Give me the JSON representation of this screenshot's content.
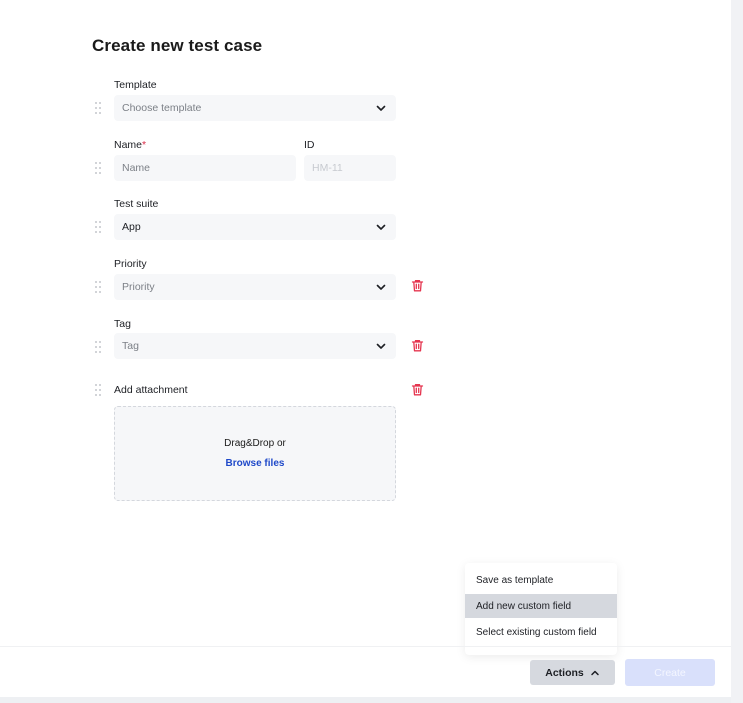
{
  "page": {
    "title": "Create new test case"
  },
  "form": {
    "template": {
      "label": "Template",
      "placeholder": "Choose template"
    },
    "name": {
      "label": "Name",
      "required_mark": "*",
      "placeholder": "Name"
    },
    "id": {
      "label": "ID",
      "placeholder": "HM-11"
    },
    "test_suite": {
      "label": "Test suite",
      "value": "App"
    },
    "priority": {
      "label": "Priority",
      "placeholder": "Priority"
    },
    "tag": {
      "label": "Tag",
      "placeholder": "Tag"
    },
    "attachment": {
      "label": "Add attachment",
      "drop_text": "Drag&Drop or",
      "browse_link": "Browse files"
    }
  },
  "actions_menu": {
    "items": [
      {
        "label": "Save as template"
      },
      {
        "label": "Add new custom field"
      },
      {
        "label": "Select existing custom field"
      }
    ],
    "highlighted_index": 1
  },
  "footer": {
    "actions_label": "Actions",
    "create_label": "Create"
  },
  "icons": {
    "drag": "drag-handle-icon",
    "chevron_down": "chevron-down-icon",
    "chevron_up": "chevron-up-icon",
    "delete": "trash-icon"
  },
  "colors": {
    "delete_icon": "#e5354f",
    "link": "#1f49c9",
    "required": "#d92c48",
    "create_disabled": "#d9e0fb"
  }
}
